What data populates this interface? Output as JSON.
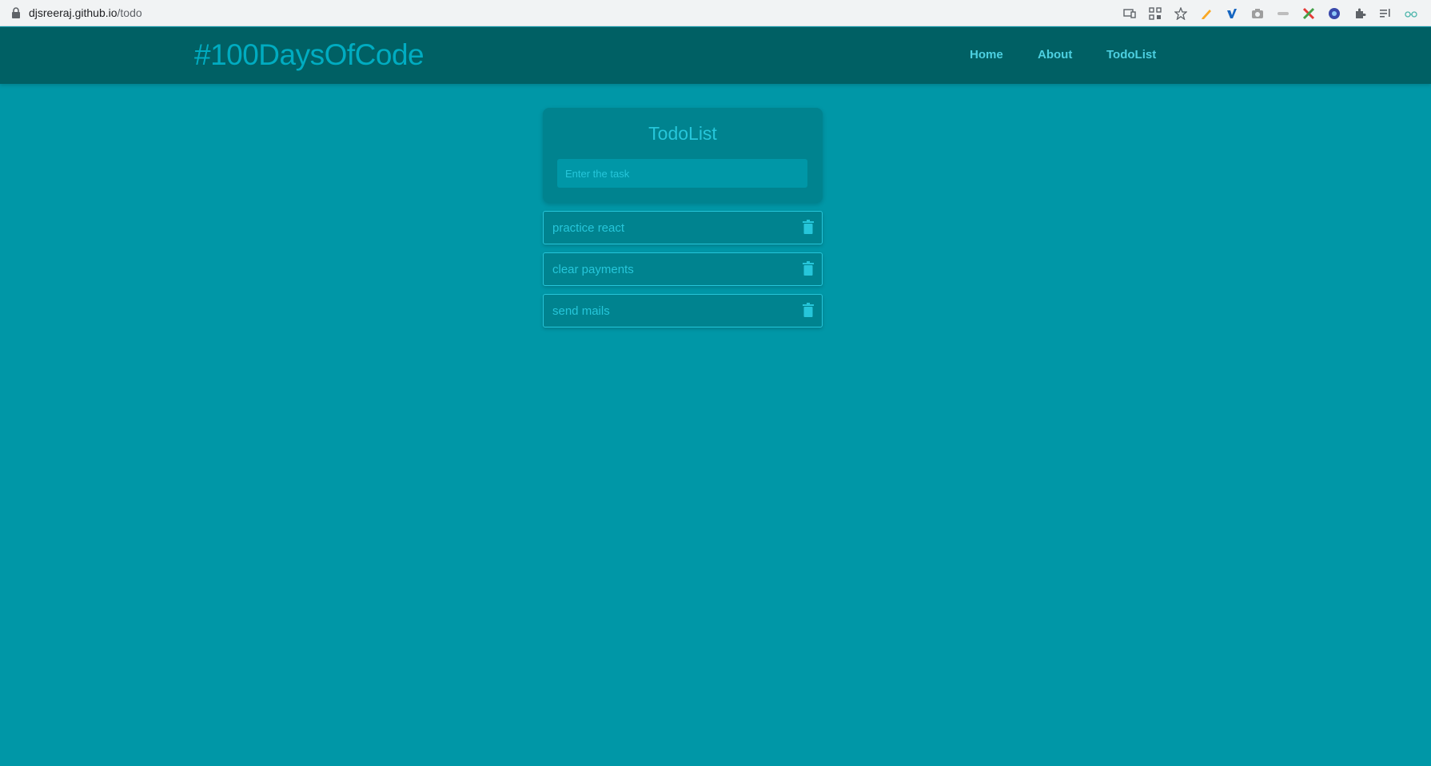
{
  "browser": {
    "url_host": "djsreeraj.github.io",
    "url_path": "/todo",
    "extensions": [
      "install-app-icon",
      "qr-icon",
      "bookmark-star-icon",
      "pencil-extension-icon",
      "vimeo-extension-icon",
      "camera-extension-icon",
      "cmd-extension-icon",
      "colorful-x-extension-icon",
      "blue-circle-extension-icon",
      "puzzle-extensions-icon",
      "reading-list-icon",
      "glasses-extension-icon"
    ]
  },
  "header": {
    "brand": "#100DaysOfCode",
    "nav": [
      {
        "label": "Home"
      },
      {
        "label": "About"
      },
      {
        "label": "TodoList"
      }
    ]
  },
  "todo": {
    "title": "TodoList",
    "input_placeholder": "Enter the task",
    "input_value": "",
    "tasks": [
      {
        "text": "practice react"
      },
      {
        "text": "clear payments"
      },
      {
        "text": "send mails"
      }
    ]
  },
  "colors": {
    "background": "#0097a7",
    "header": "#006064",
    "card": "#00838f",
    "accent": "#26c6da"
  }
}
